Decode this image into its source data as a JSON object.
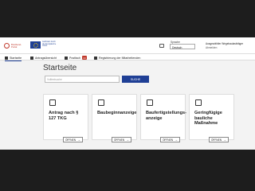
{
  "header": {
    "logo_text": "Breitband-Portal",
    "logo2_text": "Gefördert durch die Europäische Union",
    "language_label": "Sprache",
    "language_value": "Deutsch",
    "user_name": "Ausgewählter Wegebaulastträger",
    "logout_label": "Abmelden"
  },
  "nav": {
    "items": [
      {
        "label": "Startseite",
        "icon": "home-icon",
        "active": true
      },
      {
        "label": "Antragsübersicht",
        "icon": "list-icon"
      },
      {
        "label": "Postfach",
        "icon": "mail-icon",
        "badge": "10"
      },
      {
        "label": "Registrierung der Mitarbeitenden",
        "icon": "users-icon"
      }
    ]
  },
  "main": {
    "title": "Startseite",
    "search": {
      "placeholder": "Volltextsuche",
      "button_label": "SUCHE"
    },
    "cards": [
      {
        "title": "Antrag nach § 127 TKG",
        "icon": "document-icon",
        "button_label": "ÖFFNEN"
      },
      {
        "title": "Baubeginnanzeige",
        "icon": "folder-icon",
        "button_label": "ÖFFNEN"
      },
      {
        "title": "Baufertigstellungs-anzeige",
        "icon": "image-icon",
        "button_label": "ÖFFNEN"
      },
      {
        "title": "Geringfügige bauliche Maßnahme",
        "icon": "document-icon",
        "button_label": "ÖFFNEN"
      }
    ]
  },
  "colors": {
    "accent": "#1f3f95",
    "badge": "#c0392b",
    "frame": "#1d1d1d",
    "page_bg": "#f3f3f3"
  }
}
